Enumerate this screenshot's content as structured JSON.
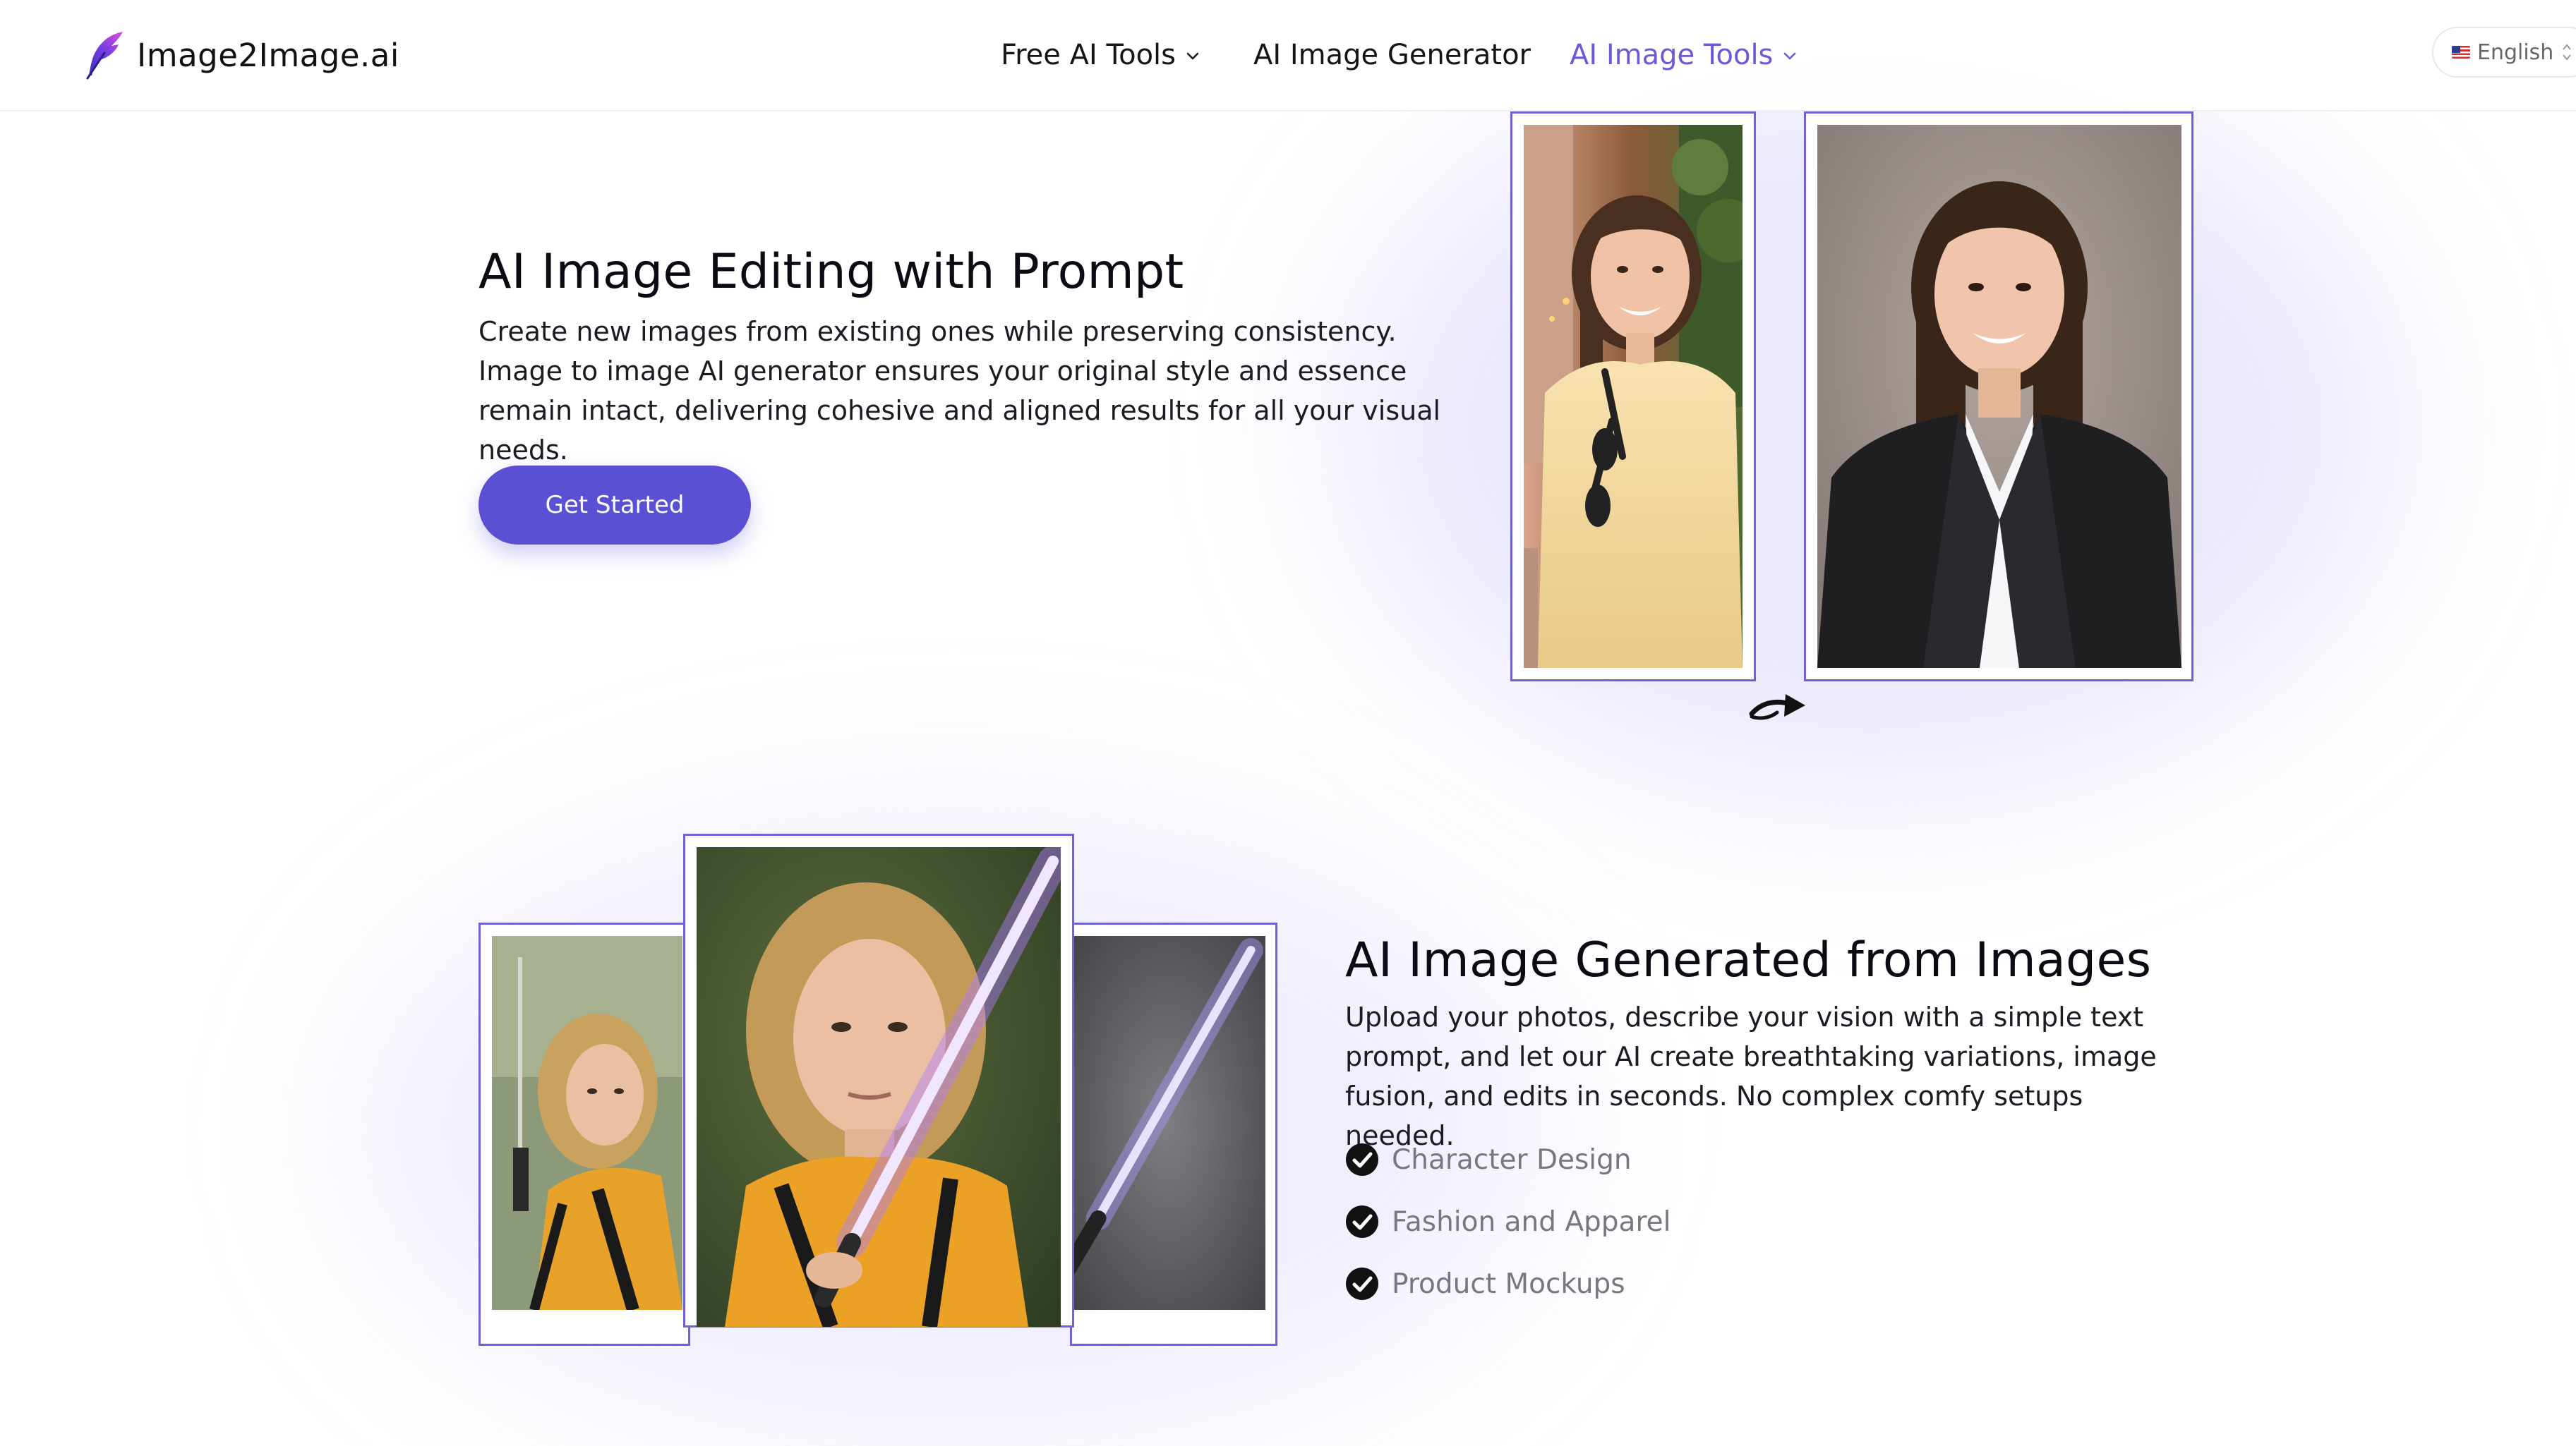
{
  "header": {
    "brand": "Image2Image.ai",
    "nav": [
      {
        "label": "Free AI Tools",
        "has_dropdown": true,
        "active": false
      },
      {
        "label": "AI Image Generator",
        "has_dropdown": false,
        "active": false
      },
      {
        "label": "AI Image Tools",
        "has_dropdown": true,
        "active": true
      }
    ],
    "language": "English"
  },
  "section1": {
    "title": "AI Image Editing with Prompt",
    "description": "Create new images from existing ones while preserving consistency. Image to image AI generator ensures your original style and essence remain intact, delivering cohesive and aligned results for all your visual needs.",
    "cta": "Get Started"
  },
  "section2": {
    "title": "AI Image Generated from Images",
    "description": "Upload your photos, describe your vision with a simple text prompt, and let our AI create breathtaking variations, image fusion, and edits in seconds. No complex comfy setups needed.",
    "features": [
      "Character Design",
      "Fashion and Apparel",
      "Product Mockups"
    ]
  },
  "colors": {
    "accent": "#5b4fd3",
    "nav_active": "#6a5ad6",
    "frame": "#6d62d8"
  },
  "icons": [
    "feather-logo-icon",
    "chevron-down-icon",
    "us-flag-icon",
    "sort-arrows-icon",
    "curved-arrow-icon",
    "check-circle-icon"
  ]
}
